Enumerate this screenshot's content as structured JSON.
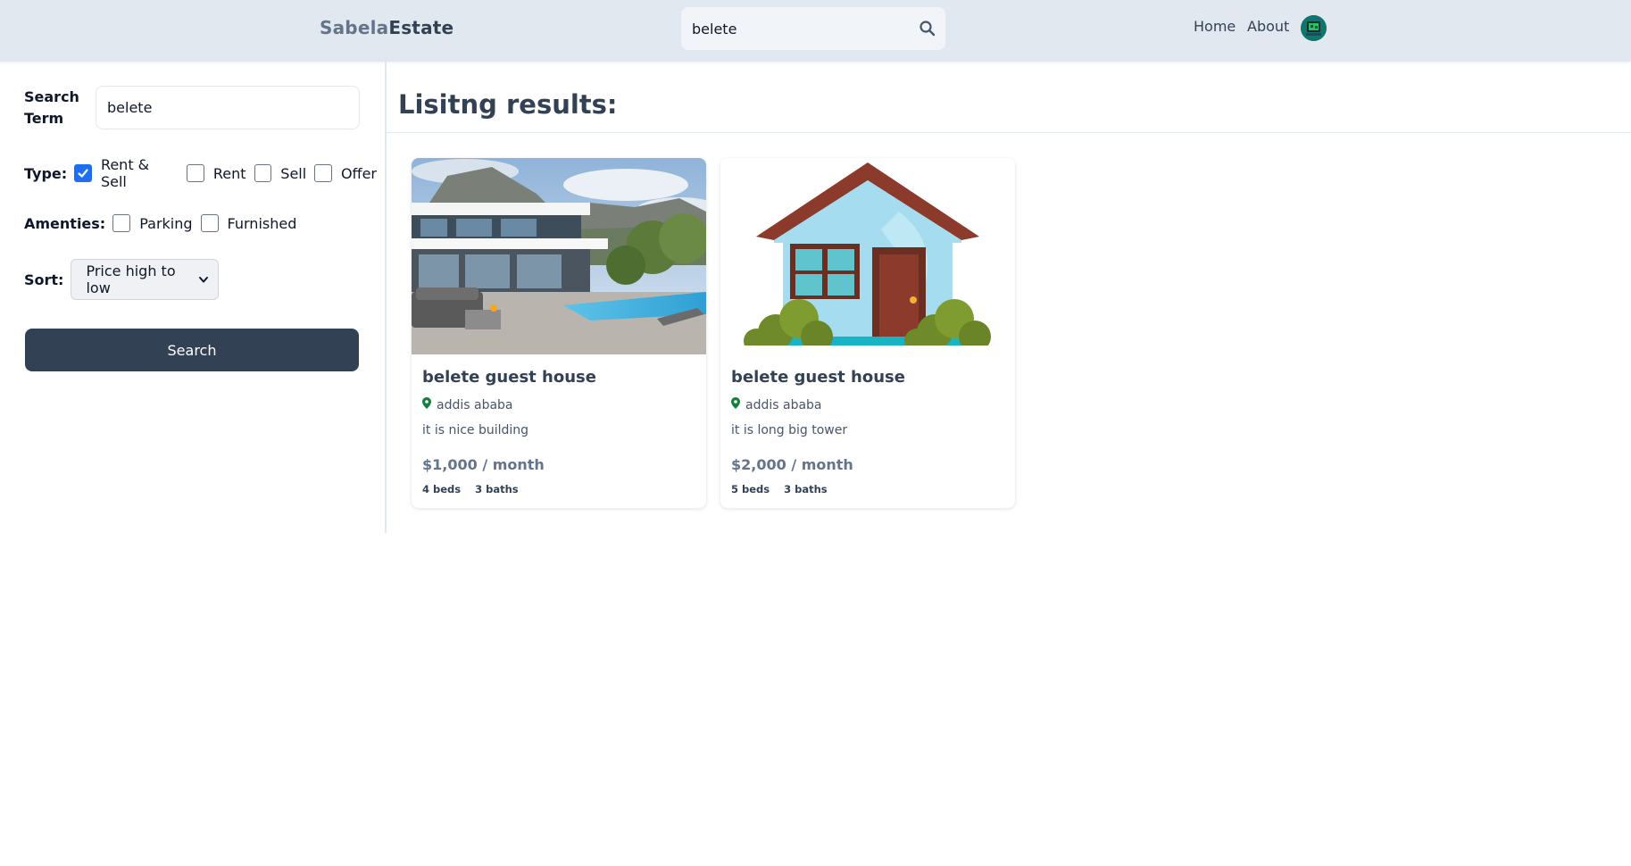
{
  "header": {
    "logo_part1": "Sabela",
    "logo_part2": "Estate",
    "search_value": "belete",
    "search_icon": "search-icon",
    "nav": {
      "home": "Home",
      "about": "About"
    }
  },
  "sidebar": {
    "search_term_label": "Search Term",
    "search_term_value": "belete",
    "type_label": "Type:",
    "type_options": [
      {
        "label": "Rent & Sell",
        "checked": true
      },
      {
        "label": "Rent",
        "checked": false
      },
      {
        "label": "Sell",
        "checked": false
      },
      {
        "label": "Offer",
        "checked": false
      }
    ],
    "amenities_label": "Amenties:",
    "amenity_options": [
      {
        "label": "Parking",
        "checked": false
      },
      {
        "label": "Furnished",
        "checked": false
      }
    ],
    "sort_label": "Sort:",
    "sort_selected": "Price high to low",
    "search_button": "Search"
  },
  "main": {
    "results_title": "Lisitng results:",
    "listings": [
      {
        "title": "belete guest house",
        "location": "addis ababa",
        "description": "it is nice building",
        "price": "$1,000 / month",
        "beds": "4 beds",
        "baths": "3 baths",
        "image": "modern-villa-pool-photo"
      },
      {
        "title": "belete guest house",
        "location": "addis ababa",
        "description": "it is long big tower",
        "price": "$2,000 / month",
        "beds": "5 beds",
        "baths": "3 baths",
        "image": "house-illustration"
      }
    ]
  },
  "colors": {
    "header_bg": "#e2e8f0",
    "button_bg": "#334155",
    "checkbox_accent": "#1d6ef1",
    "location_pin": "#15803d",
    "price_text": "#64748b"
  }
}
